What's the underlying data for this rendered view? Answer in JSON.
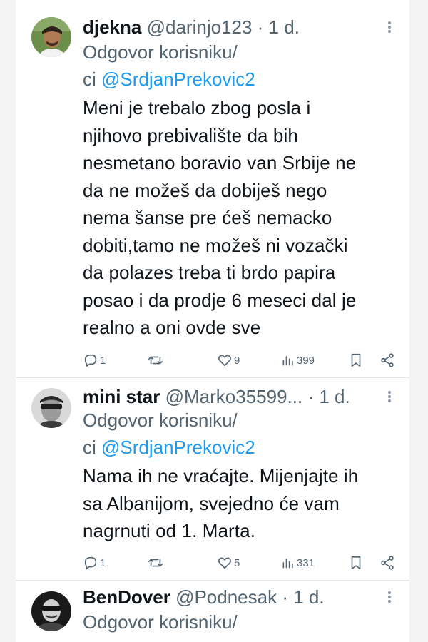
{
  "tweets": [
    {
      "name": "djekna",
      "handle": "@darinjo123",
      "dot": " · ",
      "time": "1 d.",
      "reply_prefix": "Odgovor korisniku/",
      "reply_ci": "ci ",
      "reply_to": "@SrdjanPrekovic2",
      "body_lines": [
        "Meni je trebalo zbog posla i",
        "njihovo prebivalište da bih",
        "nesmetano boravio van Srbije ne",
        "da ne možeš da dobiješ nego",
        "nema šanse pre ćeš nemacko",
        "dobiti,tamo ne možeš ni vozački",
        "da polazes treba ti brdo papira",
        "posao i da prodje 6 meseci dal je",
        "realno a oni ovde sve"
      ],
      "replies": "1",
      "retweets": "",
      "likes": "9",
      "views": "399",
      "avatar_icon": "user-avatar"
    },
    {
      "name": "mini star",
      "handle": "@Marko35599...",
      "dot": " · ",
      "time": "1 d.",
      "reply_prefix": "Odgovor korisniku/",
      "reply_ci": "ci ",
      "reply_to": "@SrdjanPrekovic2",
      "body_lines": [
        "Nama ih ne vraćajte. Mijenjajte ih",
        "sa Albanijom, svejedno će vam",
        "nagrnuti od 1. Marta."
      ],
      "replies": "1",
      "retweets": "",
      "likes": "5",
      "views": "331",
      "avatar_icon": "user-avatar"
    },
    {
      "name": "BenDover",
      "handle": "@Podnesak",
      "dot": " · ",
      "time": "1 d.",
      "reply_prefix": "Odgovor korisniku/",
      "avatar_icon": "user-avatar"
    }
  ],
  "icons": [
    "reply-icon",
    "retweet-icon",
    "like-icon",
    "views-icon",
    "bookmark-icon",
    "share-icon",
    "more-icon"
  ],
  "colors": {
    "link": "#1d9bf0",
    "muted": "#536471",
    "text": "#0f1419"
  }
}
